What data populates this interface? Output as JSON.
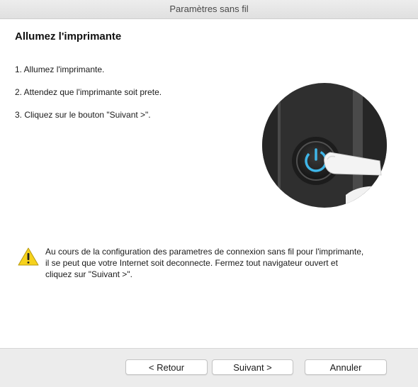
{
  "window": {
    "title": "Paramètres sans fil"
  },
  "page": {
    "heading": "Allumez l'imprimante",
    "steps": [
      "1. Allumez l'imprimante.",
      "2. Attendez que l'imprimante soit prete.",
      "3. Cliquez sur le bouton \"Suivant >\"."
    ]
  },
  "warning": {
    "icon": "warning-triangle-icon",
    "text_lines": [
      "Au cours de la configuration des parametres de connexion sans fil pour l'imprimante,",
      "il se peut que votre Internet soit deconnecte. Fermez tout navigateur ouvert et",
      "cliquez sur \"Suivant >\"."
    ]
  },
  "buttons": {
    "back": "< Retour",
    "next": "Suivant >",
    "cancel": "Annuler"
  },
  "colors": {
    "power_button_ring": "#3fb6e8",
    "warning_yellow": "#f6d21c"
  }
}
